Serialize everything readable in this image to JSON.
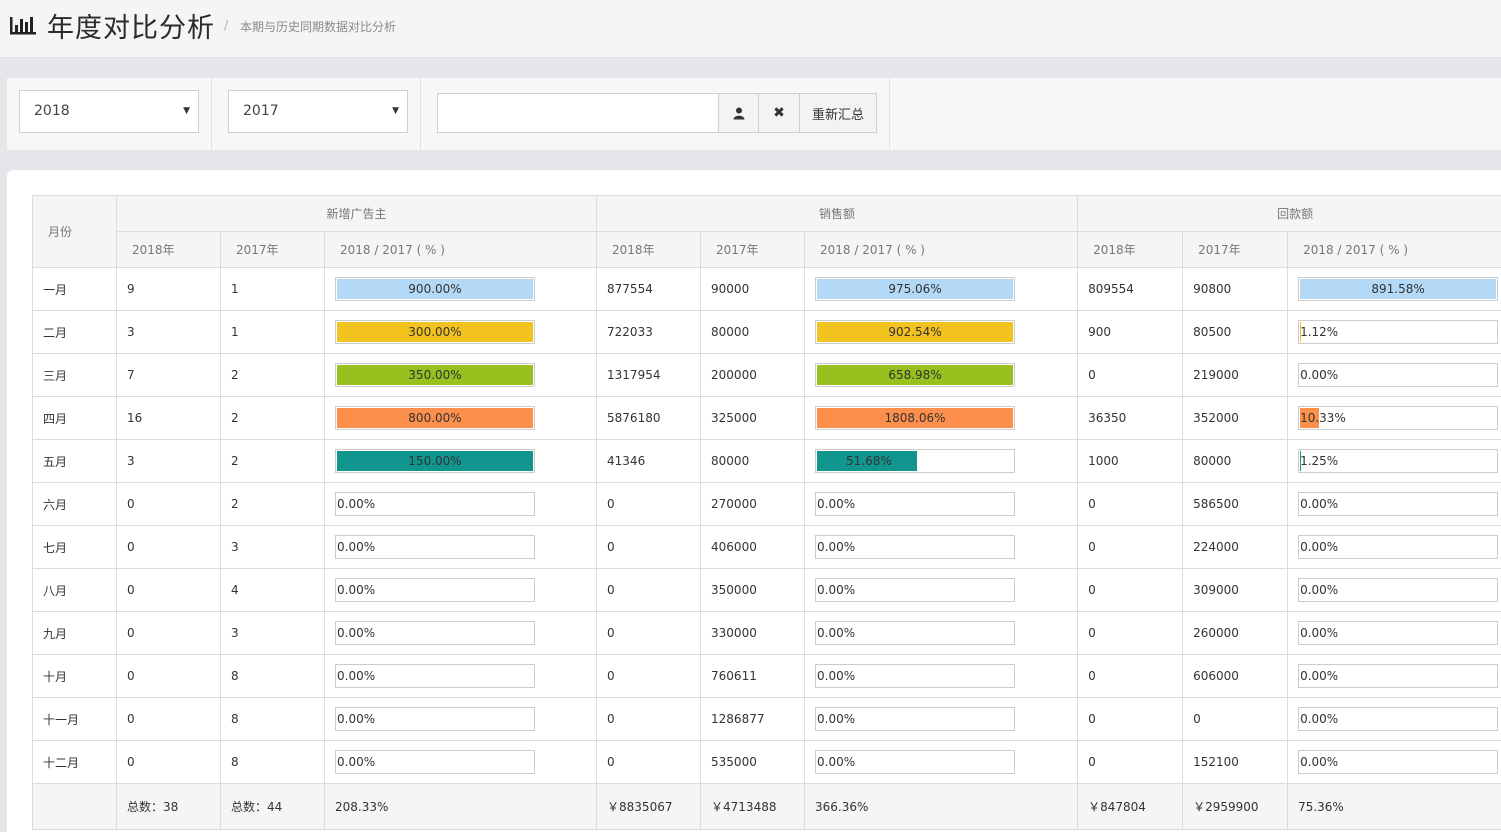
{
  "header": {
    "title": "年度对比分析",
    "separator": "/",
    "subtitle": "本期与历史同期数据对比分析"
  },
  "filters": {
    "year1": "2018",
    "year2": "2017",
    "search_value": "",
    "recompute_label": "重新汇总"
  },
  "table": {
    "month_header": "月份",
    "groups": [
      "新增广告主",
      "销售额",
      "回款额"
    ],
    "sub_headers": [
      "2018年",
      "2017年",
      "2018 / 2017 ( % )"
    ],
    "rows": [
      {
        "month": "一月",
        "a18": "9",
        "a17": "1",
        "ap": "900.00%",
        "s18": "877554",
        "s17": "90000",
        "sp": "975.06%",
        "r18": "809554",
        "r17": "90800",
        "rp": "891.58%"
      },
      {
        "month": "二月",
        "a18": "3",
        "a17": "1",
        "ap": "300.00%",
        "s18": "722033",
        "s17": "80000",
        "sp": "902.54%",
        "r18": "900",
        "r17": "80500",
        "rp": "1.12%"
      },
      {
        "month": "三月",
        "a18": "7",
        "a17": "2",
        "ap": "350.00%",
        "s18": "1317954",
        "s17": "200000",
        "sp": "658.98%",
        "r18": "0",
        "r17": "219000",
        "rp": "0.00%"
      },
      {
        "month": "四月",
        "a18": "16",
        "a17": "2",
        "ap": "800.00%",
        "s18": "5876180",
        "s17": "325000",
        "sp": "1808.06%",
        "r18": "36350",
        "r17": "352000",
        "rp": "10.33%"
      },
      {
        "month": "五月",
        "a18": "3",
        "a17": "2",
        "ap": "150.00%",
        "s18": "41346",
        "s17": "80000",
        "sp": "51.68%",
        "r18": "1000",
        "r17": "80000",
        "rp": "1.25%"
      },
      {
        "month": "六月",
        "a18": "0",
        "a17": "2",
        "ap": "0.00%",
        "s18": "0",
        "s17": "270000",
        "sp": "0.00%",
        "r18": "0",
        "r17": "586500",
        "rp": "0.00%"
      },
      {
        "month": "七月",
        "a18": "0",
        "a17": "3",
        "ap": "0.00%",
        "s18": "0",
        "s17": "406000",
        "sp": "0.00%",
        "r18": "0",
        "r17": "224000",
        "rp": "0.00%"
      },
      {
        "month": "八月",
        "a18": "0",
        "a17": "4",
        "ap": "0.00%",
        "s18": "0",
        "s17": "350000",
        "sp": "0.00%",
        "r18": "0",
        "r17": "309000",
        "rp": "0.00%"
      },
      {
        "month": "九月",
        "a18": "0",
        "a17": "3",
        "ap": "0.00%",
        "s18": "0",
        "s17": "330000",
        "sp": "0.00%",
        "r18": "0",
        "r17": "260000",
        "rp": "0.00%"
      },
      {
        "month": "十月",
        "a18": "0",
        "a17": "8",
        "ap": "0.00%",
        "s18": "0",
        "s17": "760611",
        "sp": "0.00%",
        "r18": "0",
        "r17": "606000",
        "rp": "0.00%"
      },
      {
        "month": "十一月",
        "a18": "0",
        "a17": "8",
        "ap": "0.00%",
        "s18": "0",
        "s17": "1286877",
        "sp": "0.00%",
        "r18": "0",
        "r17": "0",
        "rp": "0.00%"
      },
      {
        "month": "十二月",
        "a18": "0",
        "a17": "8",
        "ap": "0.00%",
        "s18": "0",
        "s17": "535000",
        "sp": "0.00%",
        "r18": "0",
        "r17": "152100",
        "rp": "0.00%"
      }
    ],
    "totals": {
      "a18": "总数：38",
      "a17": "总数：44",
      "ap": "208.33%",
      "s18": "￥8835067",
      "s17": "￥4713488",
      "sp": "366.36%",
      "r18": "￥847804",
      "r17": "￥2959900",
      "rp": "75.36%"
    }
  },
  "colors": {
    "row_bars": [
      "#b3d9f7",
      "#f2c21e",
      "#96c11f",
      "#fd8f4d",
      "#10958f"
    ]
  }
}
